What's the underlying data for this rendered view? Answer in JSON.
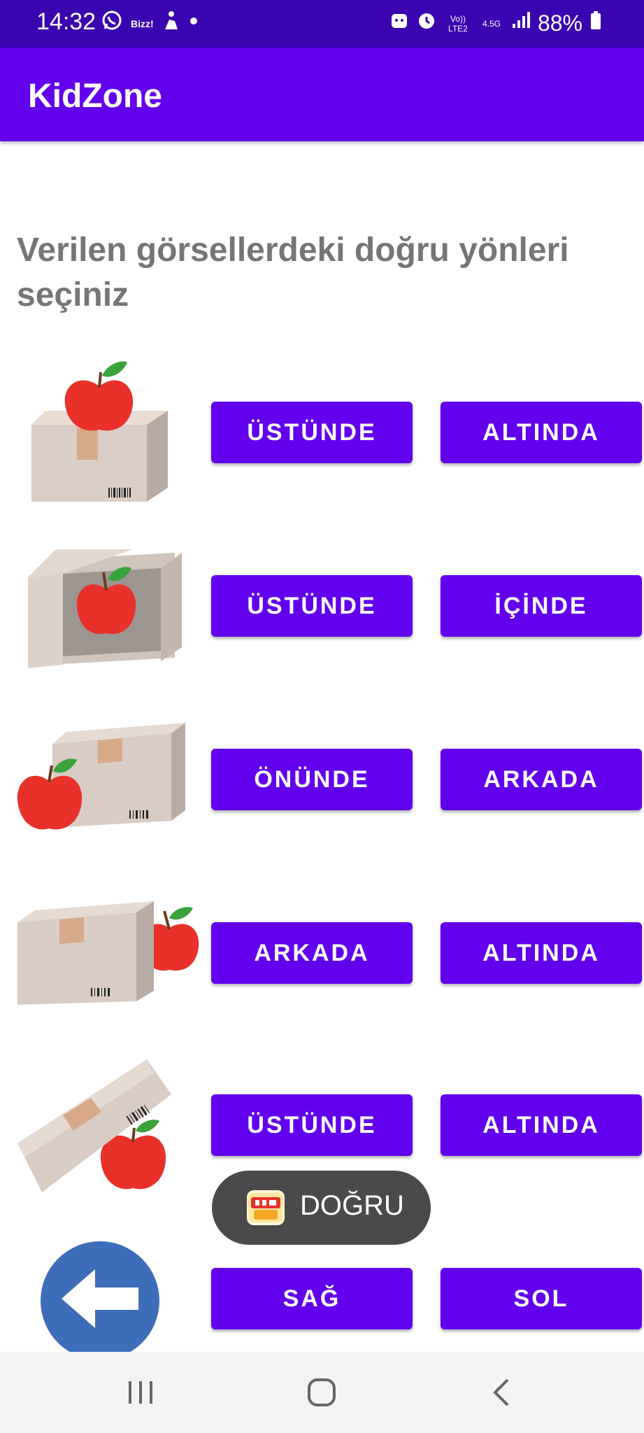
{
  "status_bar": {
    "time": "14:32",
    "notification_icons": [
      "whatsapp-icon",
      "bizz-icon",
      "figure-icon",
      "dot-icon"
    ],
    "bizz_label": "Bizz!",
    "status_icons": [
      "android-icon",
      "alarm-icon",
      "volte-icon",
      "signal-icon",
      "battery-icon"
    ],
    "volte_label": "Vo)) LTE2",
    "network_label": "4.5G",
    "battery": "88%"
  },
  "app_bar": {
    "title": "KidZone"
  },
  "instruction": "Verilen görsellerdeki doğru yönleri seçiniz",
  "rows": [
    {
      "image": "apple-on-box",
      "options": [
        "ÜSTÜNDE",
        "ALTINDA"
      ]
    },
    {
      "image": "apple-in-box",
      "options": [
        "ÜSTÜNDE",
        "İÇİNDE"
      ]
    },
    {
      "image": "apple-in-front-of-box",
      "options": [
        "ÖNÜNDE",
        "ARKADA"
      ]
    },
    {
      "image": "apple-behind-box",
      "options": [
        "ARKADA",
        "ALTINDA"
      ]
    },
    {
      "image": "apple-under-box",
      "options": [
        "ÜSTÜNDE",
        "ALTINDA"
      ]
    },
    {
      "image": "",
      "options": [
        "SAĞ",
        "SOL"
      ]
    }
  ],
  "toast": {
    "text": "DOĞRU",
    "logo": "kidzone-logo-icon"
  },
  "back_button": {
    "icon": "arrow-left-icon"
  },
  "nav_bar": {
    "icons": [
      "recents-icon",
      "home-icon",
      "back-icon"
    ]
  },
  "colors": {
    "status_bar": "#3a04b0",
    "app_bar": "#6200ee",
    "button": "#6200ee",
    "instruction_text": "#757575",
    "toast": "#4a4a4a",
    "fab": "#3d6db8",
    "apple": "#e8312b"
  }
}
